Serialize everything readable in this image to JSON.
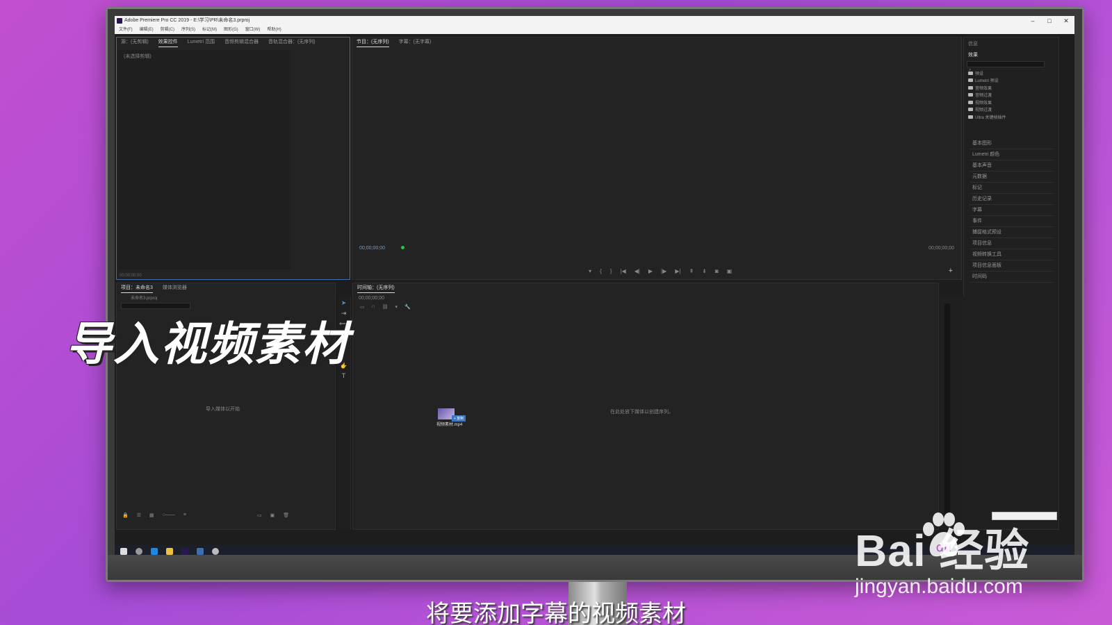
{
  "window": {
    "title": "Adobe Premiere Pro CC 2019 - E:\\学习\\PR\\未命名3.prproj",
    "minimize": "–",
    "maximize": "□",
    "close": "✕"
  },
  "menu": [
    "文件(F)",
    "编辑(E)",
    "剪辑(C)",
    "序列(S)",
    "标记(M)",
    "图形(G)",
    "窗口(W)",
    "帮助(H)"
  ],
  "source_panel": {
    "tabs": [
      "源：(无剪辑)",
      "效果控件",
      "Lumetri 范围",
      "音频剪辑混合器",
      "音轨混合器：(无序列)"
    ],
    "active_tab": 1,
    "no_clip": "(未选择剪辑)",
    "timecode": "00;00;00;00"
  },
  "program_panel": {
    "tabs": [
      "节目：(无序列)",
      "字幕：(无字幕)"
    ],
    "timecode_left": "00;00;00;00",
    "timecode_right": "00;00;00;00"
  },
  "project_panel": {
    "tabs": [
      "项目：未命名3",
      "媒体浏览器"
    ],
    "project_file": "未命名3.prproj",
    "hint": "导入媒体以开始"
  },
  "timeline_panel": {
    "tab": "时间轴：(无序列)",
    "timecode": "00;00;00;00",
    "hint": "在此处放下媒体以创建序列。",
    "drag_clip_name": "视频素材.mp4",
    "drag_badge": "+ 复制"
  },
  "right_panel": {
    "info_tab": "信息",
    "effects_tab": "效果",
    "effect_folders": [
      "预设",
      "Lumetri 预设",
      "音频效果",
      "音频过渡",
      "视频效果",
      "视频过渡",
      "Ultra 关键帧插件"
    ],
    "panels": [
      "基本图形",
      "Lumetri 颜色",
      "基本声音",
      "元数据",
      "标记",
      "历史记录",
      "字幕",
      "事件",
      "捕捉格式预设",
      "项目信息",
      "视频转换工具",
      "项目信息面板",
      "时间码"
    ]
  },
  "overlay": {
    "title": "导入视频素材",
    "subtitle": "将要添加字幕的视频素材"
  },
  "watermark": {
    "logo": "Bai  经验",
    "url": "jingyan.baidu.com"
  },
  "colors": {
    "accent_blue": "#4a90d9",
    "premiere_purple": "#2a1650",
    "playhead_green": "#2bc24a"
  }
}
